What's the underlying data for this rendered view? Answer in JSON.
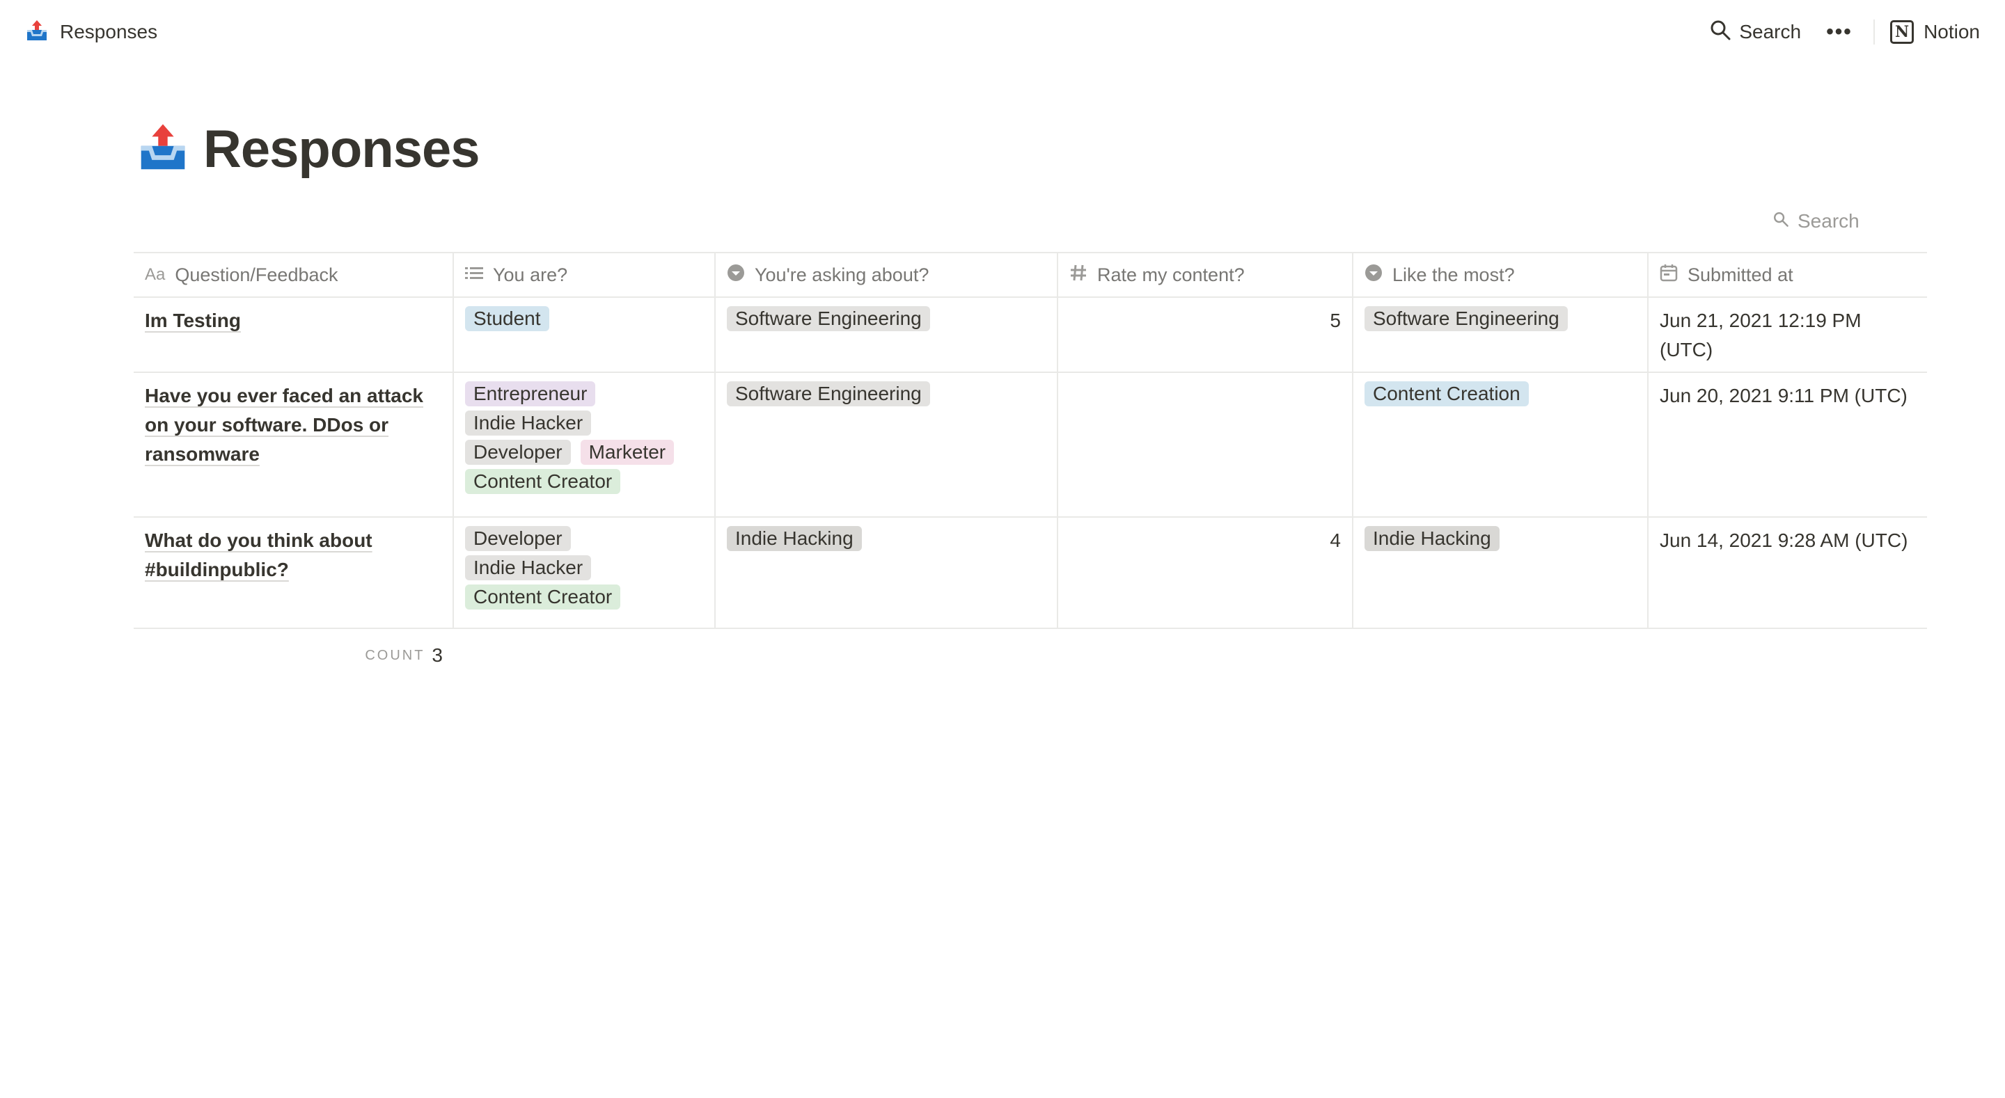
{
  "topbar": {
    "breadcrumb": "Responses",
    "search_label": "Search",
    "more_label": "•••",
    "notion_label": "Notion",
    "notion_logo_letter": "N"
  },
  "page": {
    "title": "Responses"
  },
  "view": {
    "search_label": "Search"
  },
  "table": {
    "columns": [
      {
        "label": "Question/Feedback",
        "icon": "text-aa-icon"
      },
      {
        "label": "You are?",
        "icon": "list-icon"
      },
      {
        "label": "You're asking about?",
        "icon": "select-icon"
      },
      {
        "label": "Rate my content?",
        "icon": "number-icon"
      },
      {
        "label": "Like the most?",
        "icon": "select-icon"
      },
      {
        "label": "Submitted at",
        "icon": "calendar-icon"
      }
    ],
    "rows": [
      {
        "question": "Im Testing",
        "you_are": [
          {
            "label": "Student",
            "color": "#d3e5ef"
          }
        ],
        "asking_about": [
          {
            "label": "Software Engineering",
            "color": "#e3e2e0"
          }
        ],
        "rate": "5",
        "like_most": [
          {
            "label": "Software Engineering",
            "color": "#e3e2e0"
          }
        ],
        "submitted": "Jun 21, 2021 12:19 PM (UTC)"
      },
      {
        "question": "Have you ever faced an attack on your software. DDos or ransomware",
        "you_are": [
          {
            "label": "Entrepreneur",
            "color": "#e8deee"
          },
          {
            "label": "Indie Hacker",
            "color": "#e3e2e0"
          },
          {
            "label": "Developer",
            "color": "#e3e2e0"
          },
          {
            "label": "Marketer",
            "color": "#f5e0e9"
          },
          {
            "label": "Content Creator",
            "color": "#dbeddb"
          }
        ],
        "asking_about": [
          {
            "label": "Software Engineering",
            "color": "#e3e2e0"
          }
        ],
        "rate": "",
        "like_most": [
          {
            "label": "Content Creation",
            "color": "#d3e5ef"
          }
        ],
        "submitted": "Jun 20, 2021 9:11 PM (UTC)"
      },
      {
        "question": "What do you think about #buildinpublic?",
        "you_are": [
          {
            "label": "Developer",
            "color": "#e3e2e0"
          },
          {
            "label": "Indie Hacker",
            "color": "#e3e2e0"
          },
          {
            "label": "Content Creator",
            "color": "#dbeddb"
          }
        ],
        "asking_about": [
          {
            "label": "Indie Hacking",
            "color": "#d9d8d5"
          }
        ],
        "rate": "4",
        "like_most": [
          {
            "label": "Indie Hacking",
            "color": "#d9d8d5"
          }
        ],
        "submitted": "Jun 14, 2021 9:28 AM (UTC)"
      }
    ],
    "footer": {
      "count_label": "COUNT",
      "count_value": "3"
    }
  }
}
